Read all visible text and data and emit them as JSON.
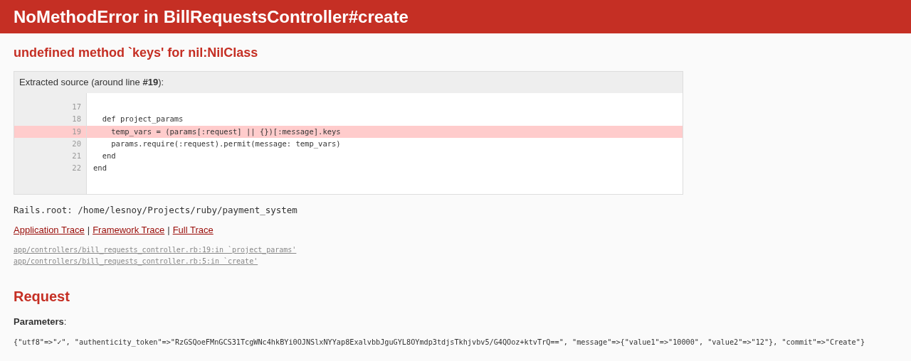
{
  "header": {
    "title": "NoMethodError in BillRequestsController#create"
  },
  "error_message": "undefined method `keys' for nil:NilClass",
  "source": {
    "caption": "Extracted source (around line **#19**):",
    "lines": [
      {
        "number": "17",
        "highlighted": false
      },
      {
        "number": "18",
        "code": "  def project_params",
        "highlighted": false
      },
      {
        "number": "19",
        "code": "    temp_vars = (params[:request] || {})[:message].keys",
        "highlighted": true
      },
      {
        "number": "20",
        "code": "    params.require(:request).permit(message: temp_vars)",
        "highlighted": false
      },
      {
        "number": "21",
        "code": "  end",
        "highlighted": false
      },
      {
        "number": "22",
        "code": "end",
        "highlighted": false
      }
    ]
  },
  "rails_root": "Rails.root: /home/lesnoy/Projects/ruby/payment_system",
  "trace_links": [
    "Application Trace",
    "Framework Trace",
    "Full Trace"
  ],
  "trace_separator": "|",
  "trace_lines": [
    "app/controllers/bill_requests_controller.rb:19:in `project_params'",
    "app/controllers/bill_requests_controller.rb:5:in `create'"
  ],
  "request": {
    "heading": "Request",
    "parameters_label": "Parameters",
    "parameters_colon": ":",
    "parameters": "{\"utf8\"=>\"✓\", \"authenticity_token\"=>\"RzGSQoeFMnGCS31TcgWNc4hkBYi0OJNSlxNYYap8ExalvbbJguGYL8OYmdp3tdjsTkhjvbv5/G4QOoz+ktvTrQ==\", \"message\"=>{\"value1\"=>\"10000\", \"value2\"=>\"12\"}, \"commit\"=>\"Create\"}"
  }
}
